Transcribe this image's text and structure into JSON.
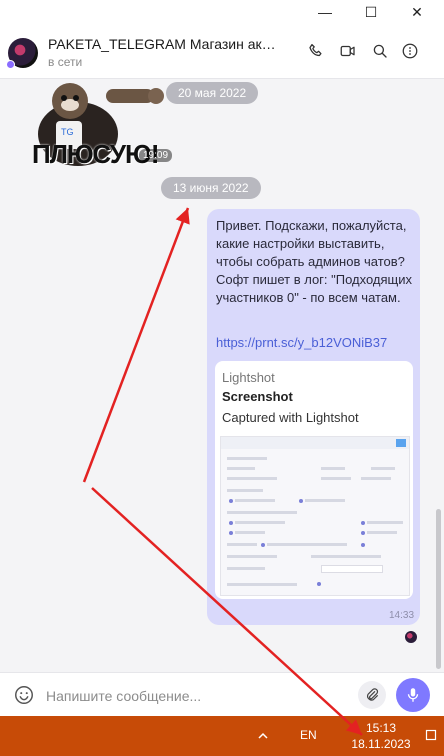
{
  "window": {
    "minimize_glyph": "—",
    "maximize_glyph": "☐",
    "close_glyph": "✕"
  },
  "header": {
    "title": "PAKETA_TELEGRAM Магазин аккаунтов",
    "status": "в сети",
    "icons": [
      "phone-icon",
      "video-camera-icon",
      "search-icon",
      "more-vertical-icon"
    ]
  },
  "chat": {
    "sticker": {
      "text": "ПЛЮСУЮ!",
      "time": "19:09"
    },
    "dates": [
      "20 мая 2022",
      "13 июня 2022"
    ],
    "message": {
      "text": "Привет. Подскажи, пожалуйста, какие настройки выставить, чтобы собрать админов чатов? Софт пишет в лог: \"Подходящих участников 0\" - по всем чатам.",
      "link": "https://prnt.sc/y_b12VONiB37",
      "time": "14:33",
      "preview": {
        "site": "Lightshot",
        "title": "Screenshot",
        "description": "Captured with Lightshot"
      }
    }
  },
  "composer": {
    "placeholder": "Напишите сообщение..."
  },
  "taskbar": {
    "language": "EN",
    "time": "15:13",
    "date": "18.11.2023",
    "color": "#c74b07"
  },
  "colors": {
    "bubble": "#d9d9fb",
    "accent": "#7f79ff",
    "annotation_arrow": "#e32222"
  }
}
